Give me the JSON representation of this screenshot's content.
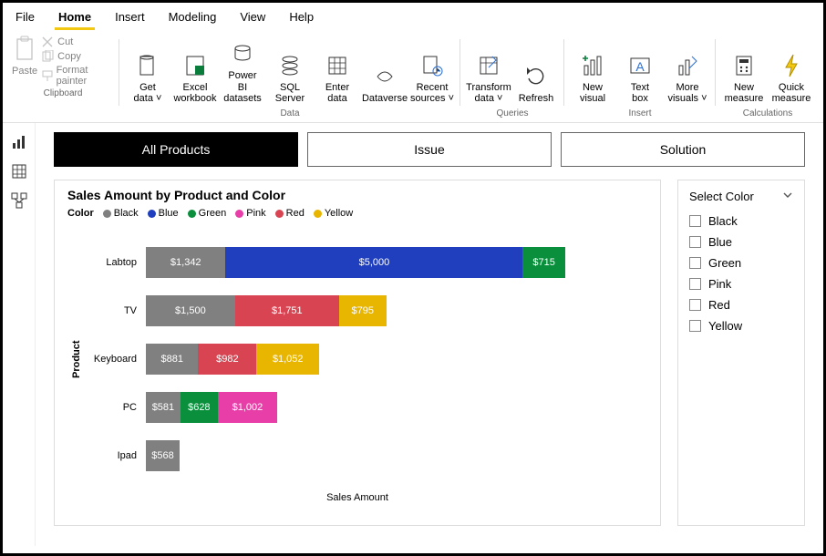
{
  "menu": [
    "File",
    "Home",
    "Insert",
    "Modeling",
    "View",
    "Help"
  ],
  "menu_active": "Home",
  "ribbon": {
    "clipboard": {
      "label": "Clipboard",
      "paste": "Paste",
      "cut": "Cut",
      "copy": "Copy",
      "format_painter": "Format painter"
    },
    "data": {
      "label": "Data",
      "items": [
        "Get data",
        "Excel workbook",
        "Power BI datasets",
        "SQL Server",
        "Enter data",
        "Dataverse",
        "Recent sources"
      ]
    },
    "queries": {
      "label": "Queries",
      "items": [
        "Transform data",
        "Refresh"
      ]
    },
    "insert": {
      "label": "Insert",
      "items": [
        "New visual",
        "Text box",
        "More visuals"
      ]
    },
    "calculations": {
      "label": "Calculations",
      "items": [
        "New measure",
        "Quick measure"
      ]
    }
  },
  "tabs": [
    "All Products",
    "Issue",
    "Solution"
  ],
  "tabs_selected": 0,
  "slicer": {
    "title": "Select Color",
    "options": [
      "Black",
      "Blue",
      "Green",
      "Pink",
      "Red",
      "Yellow"
    ]
  },
  "chart_data": {
    "type": "bar",
    "title": "Sales Amount by Product and Color",
    "legend_label": "Color",
    "xlabel": "Sales Amount",
    "ylabel": "Product",
    "colors": {
      "Black": "#808080",
      "Blue": "#1f3fbf",
      "Green": "#0a8f3c",
      "Pink": "#e83ea8",
      "Red": "#d94452",
      "Yellow": "#e8b500"
    },
    "categories": [
      "Labtop",
      "TV",
      "Keyboard",
      "PC",
      "Ipad"
    ],
    "stacks": [
      [
        {
          "c": "Black",
          "v": 1342,
          "l": "$1,342"
        },
        {
          "c": "Blue",
          "v": 5000,
          "l": "$5,000"
        },
        {
          "c": "Green",
          "v": 715,
          "l": "$715"
        }
      ],
      [
        {
          "c": "Black",
          "v": 1500,
          "l": "$1,500"
        },
        {
          "c": "Red",
          "v": 1751,
          "l": "$1,751"
        },
        {
          "c": "Yellow",
          "v": 795,
          "l": "$795"
        }
      ],
      [
        {
          "c": "Black",
          "v": 881,
          "l": "$881"
        },
        {
          "c": "Red",
          "v": 982,
          "l": "$982"
        },
        {
          "c": "Yellow",
          "v": 1052,
          "l": "$1,052"
        }
      ],
      [
        {
          "c": "Black",
          "v": 581,
          "l": "$581"
        },
        {
          "c": "Green",
          "v": 628,
          "l": "$628"
        },
        {
          "c": "Pink",
          "v": 1002,
          "l": "$1,002"
        }
      ],
      [
        {
          "c": "Black",
          "v": 568,
          "l": "$568"
        }
      ]
    ],
    "max_total": 7057
  }
}
